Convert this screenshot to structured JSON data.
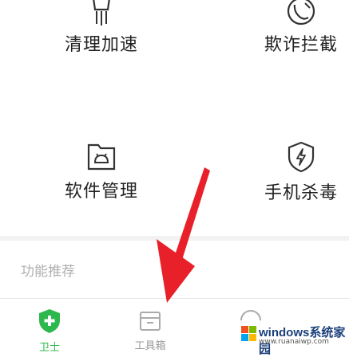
{
  "tools": [
    {
      "label": "清理加速",
      "icon": "broom-icon"
    },
    {
      "label": "欺诈拦截",
      "icon": "phone-block-icon"
    },
    {
      "label": "软件管理",
      "icon": "android-folder-icon"
    },
    {
      "label": "手机杀毒",
      "icon": "shield-bolt-icon"
    }
  ],
  "section": {
    "title": "功能推荐"
  },
  "tabs": [
    {
      "label": "卫士",
      "icon": "shield-plus-icon",
      "active": true
    },
    {
      "label": "工具箱",
      "icon": "toolbox-icon",
      "active": false
    },
    {
      "label": "",
      "icon": "profile-icon",
      "active": false
    }
  ],
  "colors": {
    "accent": "#2db84d",
    "arrow": "#e8202a",
    "text": "#222222"
  },
  "watermark": {
    "title": "windows系统家园",
    "url": "www.ruanaiwp.com"
  }
}
